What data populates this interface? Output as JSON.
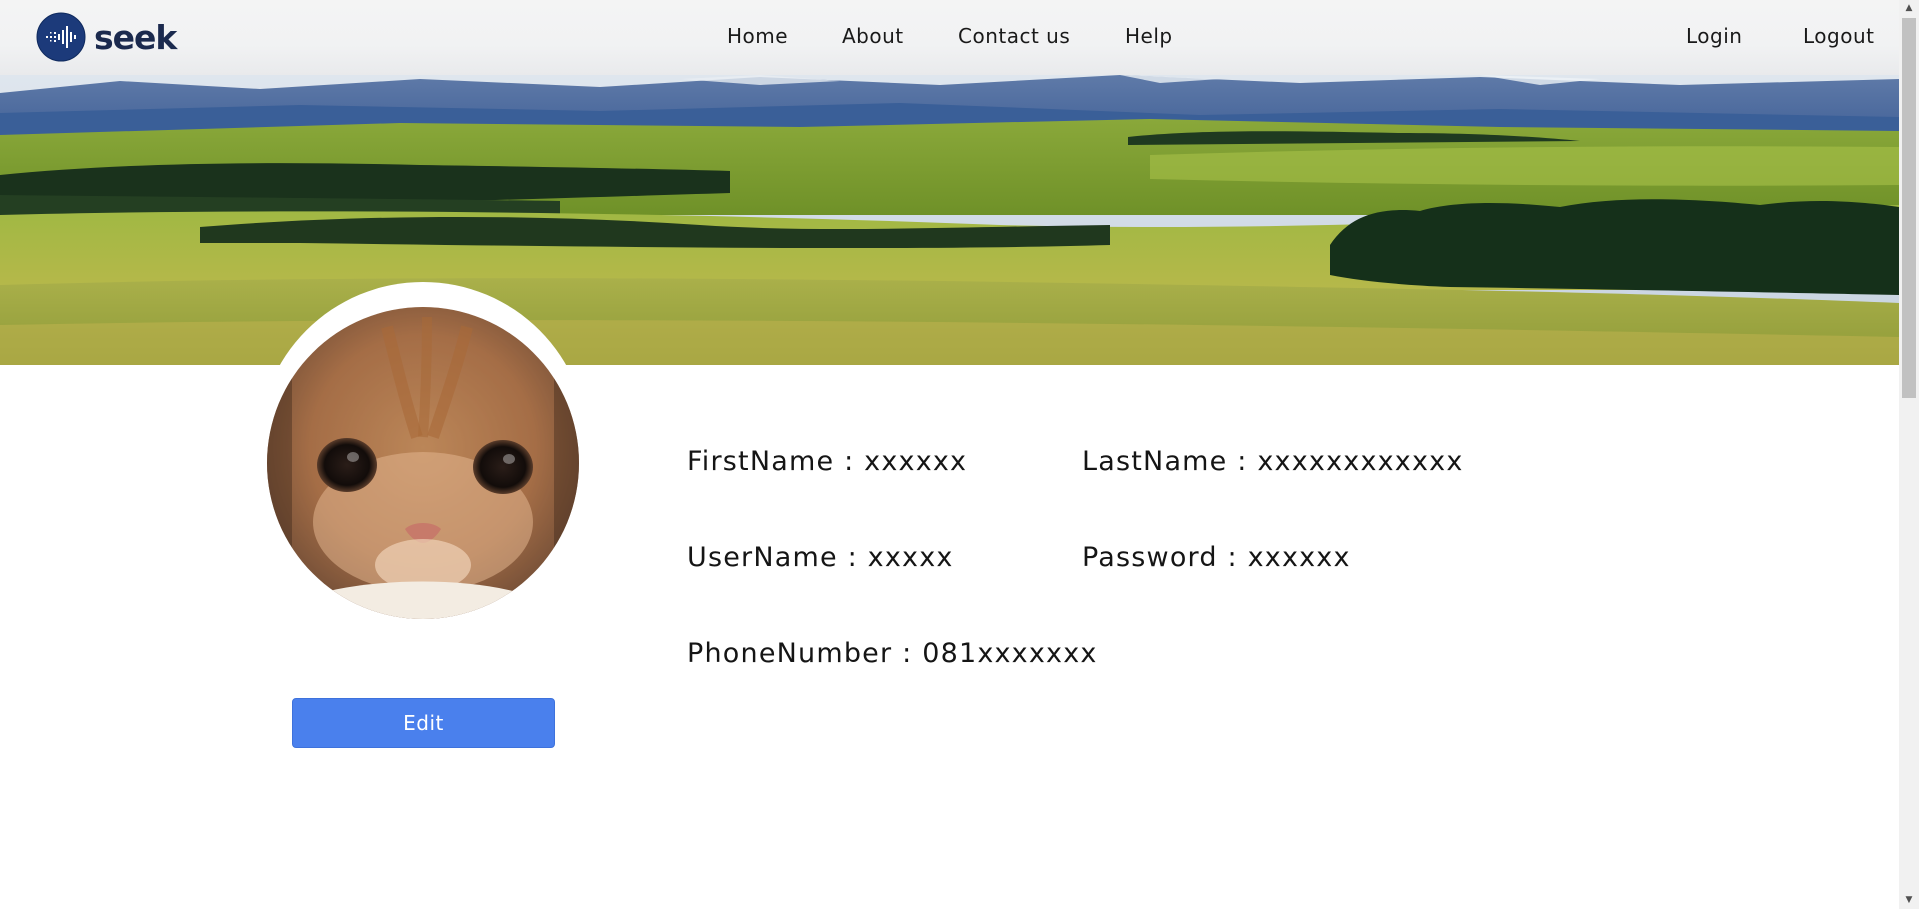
{
  "brand": {
    "name": "seek",
    "logo_icon": "seek-logo-icon",
    "color": "#1b2a4e"
  },
  "nav": {
    "home": "Home",
    "about": "About",
    "contact": "Contact us",
    "help": "Help",
    "login": "Login",
    "logout": "Logout"
  },
  "banner": {
    "image": "landscape-banner-image"
  },
  "profile": {
    "avatar_image": "cat-avatar-image",
    "edit_label": "Edit",
    "separator": " : ",
    "first_name": {
      "label": "FirstName",
      "value": "xxxxxx"
    },
    "last_name": {
      "label": "LastName",
      "value": "xxxxxxxxxxxx"
    },
    "username": {
      "label": "UserName",
      "value": "xxxxx"
    },
    "password": {
      "label": "Password",
      "value": "xxxxxx"
    },
    "phone": {
      "label": "PhoneNumber",
      "value": "081xxxxxxx"
    }
  },
  "colors": {
    "accent": "#4a80ed",
    "text": "#151515"
  }
}
